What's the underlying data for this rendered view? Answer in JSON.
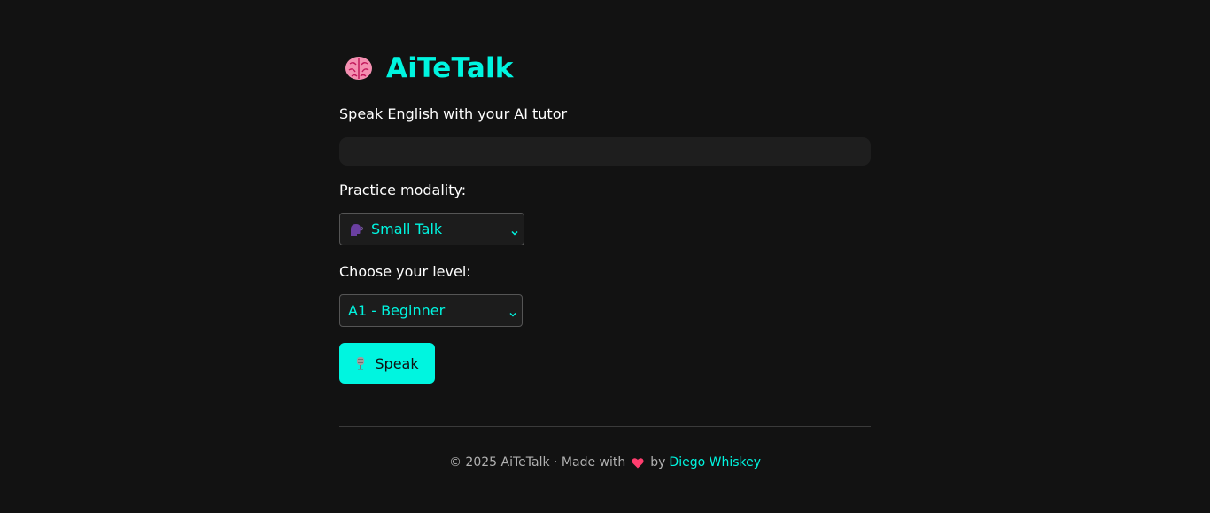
{
  "header": {
    "title": "AiTeTalk",
    "icon": "brain-icon",
    "title_color": "#00f5e0"
  },
  "subtitle": "Speak English with your AI tutor",
  "modality": {
    "label": "Practice modality:",
    "selected": "Small Talk",
    "icon": "speaking-head-icon"
  },
  "level": {
    "label": "Choose your level:",
    "selected": "A1 - Beginner"
  },
  "speak_button": {
    "label": "Speak",
    "icon": "microphone-icon",
    "color": "#00f5e0"
  },
  "footer": {
    "text_before": "© 2025 AiTeTalk · Made with",
    "text_after": "by",
    "author_link": "Diego Whiskey",
    "heart_icon": "heart-icon"
  }
}
